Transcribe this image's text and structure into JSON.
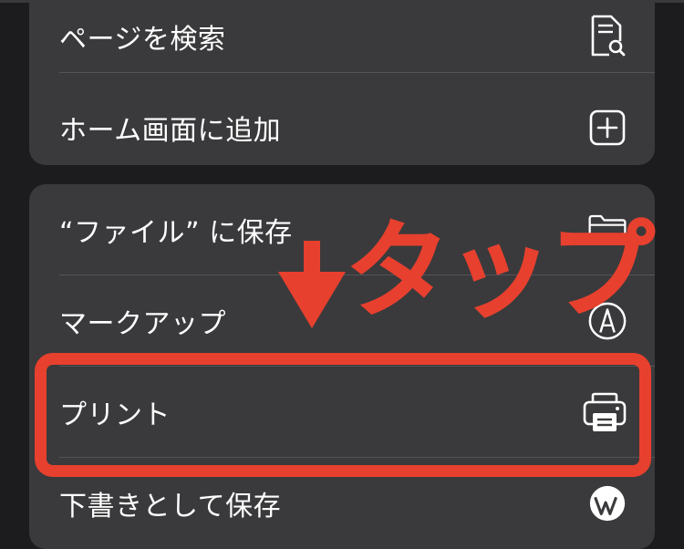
{
  "menu": {
    "group1": [
      {
        "label": "ページを検索",
        "icon": "find-on-page-icon"
      },
      {
        "label": "ホーム画面に追加",
        "icon": "add-square-icon"
      }
    ],
    "group2": [
      {
        "label": "“ファイル” に保存",
        "icon": "folder-icon"
      },
      {
        "label": "マークアップ",
        "icon": "markup-pen-icon"
      },
      {
        "label": "プリント",
        "icon": "printer-icon"
      },
      {
        "label": "下書きとして保存",
        "icon": "wordpress-icon"
      }
    ]
  },
  "annotation": {
    "text": "タップ",
    "color": "#e8402e"
  },
  "colors": {
    "background": "#1c1c1e",
    "group_bg": "#3a3a3c",
    "separator": "#545458",
    "text": "#ffffff",
    "annotation": "#e8402e"
  }
}
